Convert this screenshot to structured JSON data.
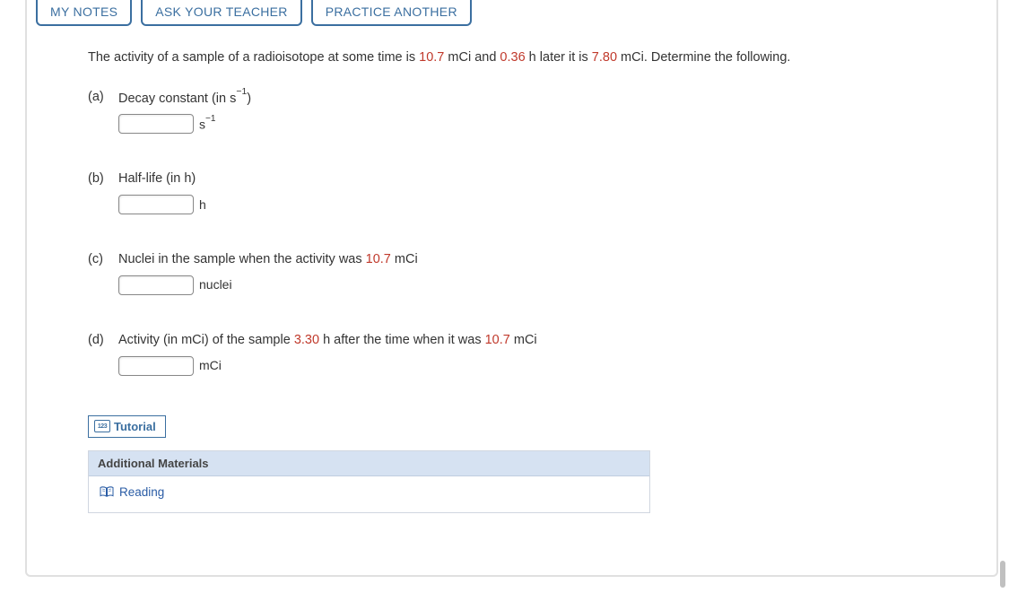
{
  "tabs": {
    "my_notes": "MY NOTES",
    "ask_teacher": "ASK YOUR TEACHER",
    "practice_another": "PRACTICE ANOTHER"
  },
  "problem": {
    "intro_pre": "The activity of a sample of a radioisotope at some time is ",
    "val1": "10.7",
    "intro_mid1": " mCi and ",
    "val2": "0.36",
    "intro_mid2": " h later it is ",
    "val3": "7.80",
    "intro_post": " mCi. Determine the following."
  },
  "parts": {
    "a": {
      "label": "(a)",
      "text": "Decay constant (in s",
      "text_sup": "−1",
      "text_end": ")",
      "unit_base": "s",
      "unit_sup": "−1"
    },
    "b": {
      "label": "(b)",
      "text": "Half-life (in h)",
      "unit": "h"
    },
    "c": {
      "label": "(c)",
      "text_pre": "Nuclei in the sample when the activity was ",
      "val": "10.7",
      "text_post": " mCi",
      "unit": "nuclei"
    },
    "d": {
      "label": "(d)",
      "text_pre": "Activity (in mCi) of the sample ",
      "val1": "3.30",
      "text_mid": " h after the time when it was ",
      "val2": "10.7",
      "text_post": " mCi",
      "unit": "mCi"
    }
  },
  "tutorial": {
    "label": "Tutorial",
    "icon_text": "123"
  },
  "materials": {
    "header": "Additional Materials",
    "reading": "Reading"
  }
}
